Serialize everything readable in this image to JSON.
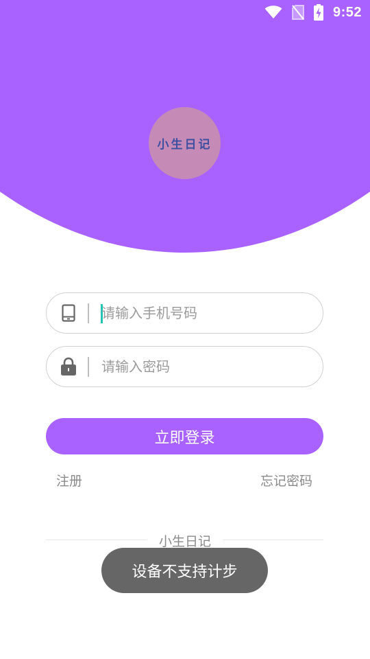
{
  "status_bar": {
    "time": "9:52",
    "icons": [
      "wifi-icon",
      "no-sim-icon",
      "battery-charging-icon"
    ]
  },
  "logo": {
    "text": "小生日记"
  },
  "form": {
    "phone_placeholder": "请输入手机号码",
    "phone_value": "",
    "phone_icon": "phone-icon",
    "password_placeholder": "请输入密码",
    "password_value": "",
    "password_icon": "lock-icon"
  },
  "actions": {
    "login_label": "立即登录",
    "register_label": "注册",
    "forgot_label": "忘记密码"
  },
  "footer": {
    "text": "小生日记"
  },
  "toast": {
    "message": "设备不支持计步"
  },
  "colors": {
    "accent": "#a962ff",
    "logo_bg": "#c68ab6",
    "logo_text": "#3d4fa0",
    "cursor": "#22c4b4",
    "toast_bg": "#666666"
  }
}
